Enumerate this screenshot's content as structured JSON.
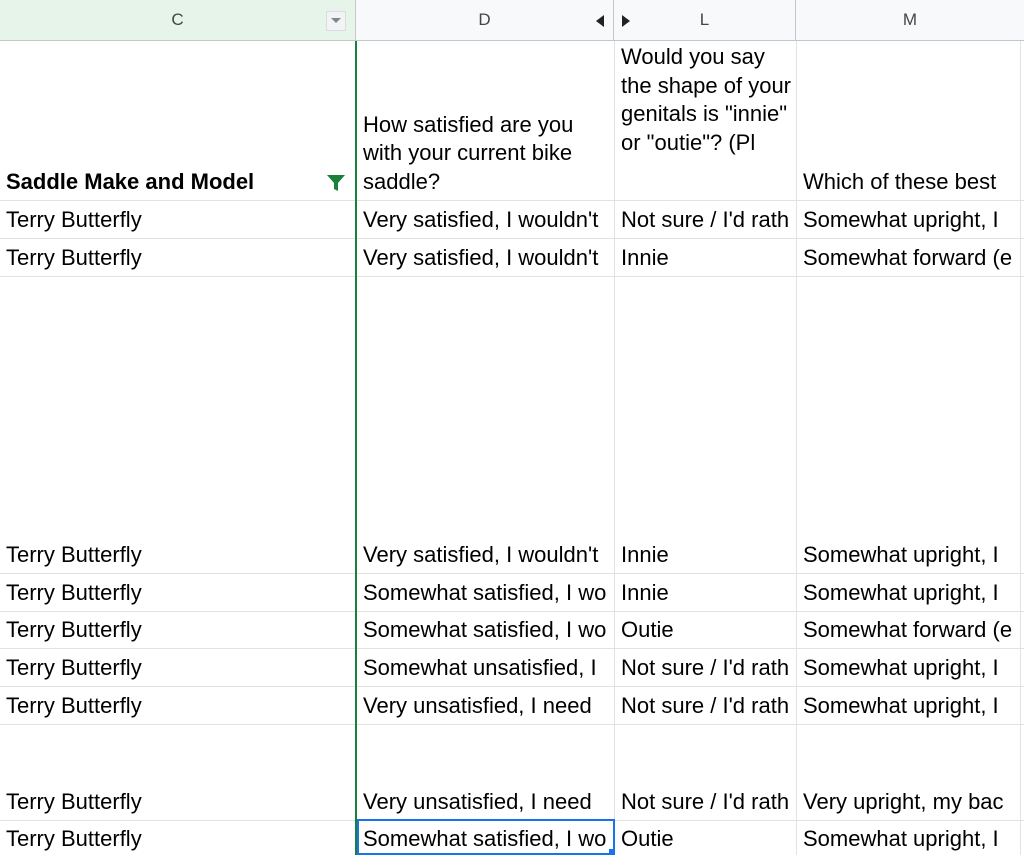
{
  "columns": {
    "c": "C",
    "d": "D",
    "l": "L",
    "m": "M"
  },
  "header": {
    "c": "Saddle Make and Model",
    "d": "How satisfied are you with your current bike saddle?",
    "l": "Would you say the shape of your genitals is \"innie\" or \"outie\"? (Pl",
    "m": "Which of these best"
  },
  "rows": [
    {
      "c": "Terry Butterfly",
      "d": "Very satisfied, I wouldn't",
      "l": "Not sure / I'd rath",
      "m": "Somewhat upright, I"
    },
    {
      "c": "Terry Butterfly",
      "d": "Very satisfied, I wouldn't",
      "l": "Innie",
      "m": "Somewhat forward (e"
    },
    {
      "c": "Terry Butterfly",
      "d": "Very satisfied, I wouldn't",
      "l": "Innie",
      "m": "Somewhat upright, I"
    },
    {
      "c": "Terry Butterfly",
      "d": "Somewhat satisfied, I wo",
      "l": "Innie",
      "m": "Somewhat upright, I"
    },
    {
      "c": "Terry Butterfly",
      "d": "Somewhat satisfied, I wo",
      "l": "Outie",
      "m": "Somewhat forward (e"
    },
    {
      "c": "Terry Butterfly",
      "d": "Somewhat unsatisfied, I",
      "l": "Not sure / I'd rath",
      "m": "Somewhat upright, I"
    },
    {
      "c": "Terry Butterfly",
      "d": "Very unsatisfied, I need",
      "l": "Not sure / I'd rath",
      "m": "Somewhat upright, I"
    },
    {
      "c": "Terry Butterfly",
      "d": "Very unsatisfied, I need",
      "l": "Not sure / I'd rath",
      "m": "Very upright, my bac"
    },
    {
      "c": "Terry Butterfly",
      "d": "Somewhat satisfied, I wo",
      "l": "Outie",
      "m": "Somewhat upright, I"
    }
  ],
  "colors": {
    "filter": "#188038",
    "freeze_line": "#188038",
    "selection": "#1a73e8",
    "filtered_header_bg": "#e6f4ea"
  }
}
